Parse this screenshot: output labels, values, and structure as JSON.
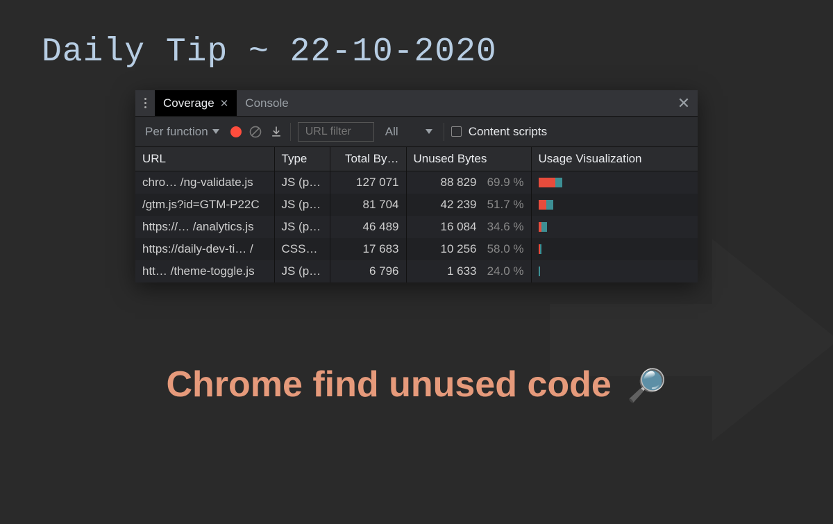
{
  "header": {
    "title": "Daily Tip ~ 22-10-2020"
  },
  "panel": {
    "tabs": {
      "coverage": "Coverage",
      "console": "Console"
    },
    "toolbar": {
      "mode": "Per function",
      "url_filter_placeholder": "URL filter",
      "type_filter": "All",
      "content_scripts_label": "Content scripts"
    },
    "columns": {
      "url": "URL",
      "type": "Type",
      "total": "Total By…",
      "unused": "Unused Bytes",
      "viz": "Usage Visualization"
    },
    "rows": [
      {
        "url": "chro…  /ng-validate.js",
        "type": "JS (p…",
        "total": "127 071",
        "unused": "88 829",
        "pct": "69.9 %",
        "red": 11.0,
        "teal": 4.7
      },
      {
        "url": "/gtm.js?id=GTM-P22C",
        "type": "JS (p…",
        "total": "81 704",
        "unused": "42 239",
        "pct": "51.7 %",
        "red": 5.2,
        "teal": 4.8
      },
      {
        "url": "https://…  /analytics.js",
        "type": "JS (p…",
        "total": "46 489",
        "unused": "16 084",
        "pct": "34.6 %",
        "red": 2.0,
        "teal": 3.8
      },
      {
        "url": "https://daily-dev-ti…  /",
        "type": "CSS…",
        "total": "17 683",
        "unused": "10 256",
        "pct": "58.0 %",
        "red": 1.3,
        "teal": 0.9
      },
      {
        "url": "htt…  /theme-toggle.js",
        "type": "JS (p…",
        "total": "6 796",
        "unused": "1 633",
        "pct": "24.0 %",
        "red": 0.3,
        "teal": 0.7
      }
    ]
  },
  "caption": {
    "text": "Chrome find unused code",
    "emoji": "🔎"
  }
}
